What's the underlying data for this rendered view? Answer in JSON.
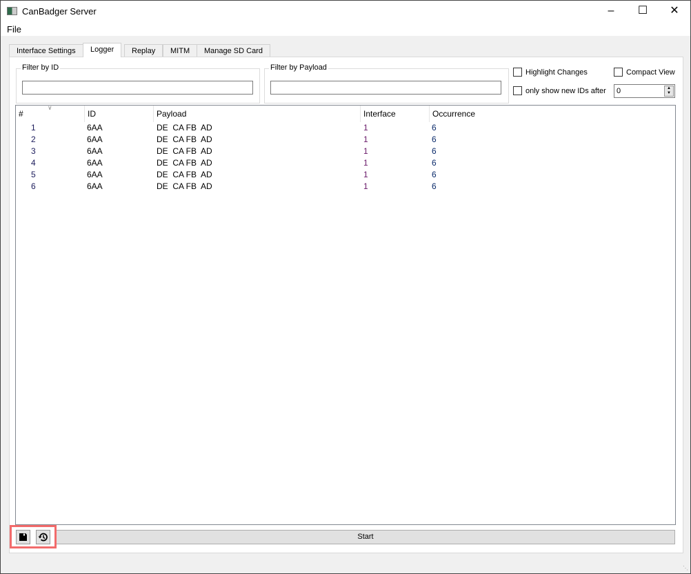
{
  "window": {
    "title": "CanBadger Server"
  },
  "menu": {
    "items": [
      "File"
    ]
  },
  "tabs": [
    {
      "label": "Interface Settings"
    },
    {
      "label": "Logger",
      "active": true
    },
    {
      "label": "Replay"
    },
    {
      "label": "MITM"
    },
    {
      "label": "Manage SD Card"
    }
  ],
  "filters": {
    "id_label": "Filter by ID",
    "id_value": "",
    "payload_label": "Filter by Payload",
    "payload_value": ""
  },
  "options": {
    "highlight_changes": "Highlight Changes",
    "highlight_checked": false,
    "compact_view": "Compact View",
    "compact_checked": false,
    "only_new": "only show new IDs after",
    "only_new_checked": false,
    "only_new_value": "0"
  },
  "table": {
    "columns": [
      "#",
      "ID",
      "Payload",
      "Interface",
      "Occurrence"
    ],
    "rows": [
      [
        "1",
        "6AA",
        "DE  CA FB  AD",
        "1",
        "6"
      ],
      [
        "2",
        "6AA",
        "DE  CA FB  AD",
        "1",
        "6"
      ],
      [
        "3",
        "6AA",
        "DE  CA FB  AD",
        "1",
        "6"
      ],
      [
        "4",
        "6AA",
        "DE  CA FB  AD",
        "1",
        "6"
      ],
      [
        "5",
        "6AA",
        "DE  CA FB  AD",
        "1",
        "6"
      ],
      [
        "6",
        "6AA",
        "DE  CA FB  AD",
        "1",
        "6"
      ]
    ]
  },
  "bottom": {
    "save_icon": "floppy-disk",
    "history_icon": "history-clock",
    "start_label": "Start",
    "highlight_color": "#f26b6b"
  }
}
